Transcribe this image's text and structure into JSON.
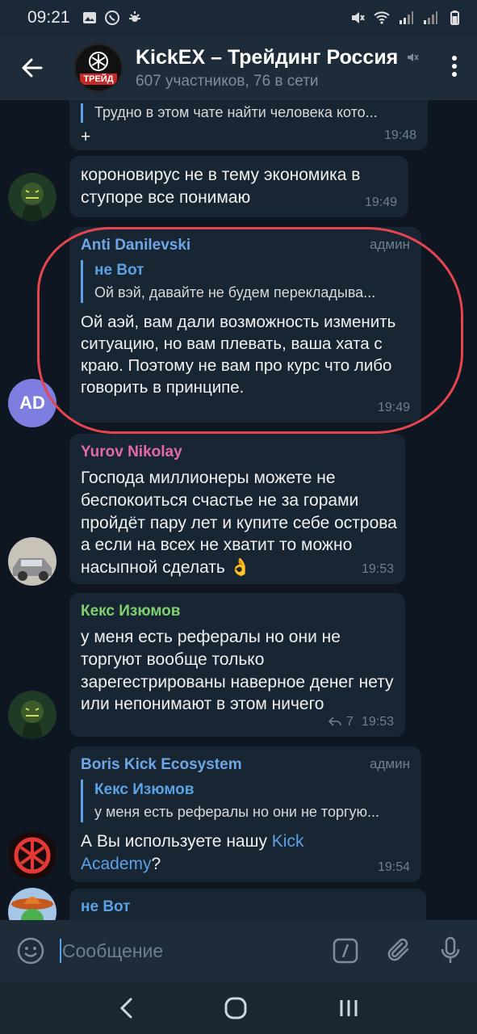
{
  "status": {
    "time": "09:21"
  },
  "chat": {
    "title": "KickEX – Трейдинг Россия",
    "subtitle": "607 участников, 76 в сети",
    "avatar_badge": "ТРЕЙД"
  },
  "messages": [
    {
      "text1": "Трудно в этом чате найти человека кото...",
      "text2": "+",
      "time": "19:48"
    },
    {
      "text": "короновирус не в тему экономика в ступоре все понимаю",
      "time": "19:49"
    },
    {
      "sender": "Anti Danilevski",
      "role": "админ",
      "reply_name": "не Вот",
      "reply_text": "Ой вэй,  давайте не будем перекладыва...",
      "text": "Ой аэй, вам дали возможность изменить ситуацию, но вам плевать, ваша хата с краю. Поэтому не вам про курс что либо говорить в принципе.",
      "time": "19:49",
      "avatar_initials": "AD"
    },
    {
      "sender": "Yurov Nikolay",
      "text": "Господа миллионеры можете не беспокоиться счастье не за горами пройдёт пару лет и купите себе острова а если на всех не хватит то можно насыпной сделать 👌",
      "time": "19:53"
    },
    {
      "sender": "Кекс Изюмов",
      "text": "у меня есть рефералы но они не торгуют вообще только зарегестрированы наверное денег нету или непонимают в этом ничего",
      "replies": "7",
      "time": "19:53"
    },
    {
      "sender": "Boris Kick Ecosystem",
      "role": "админ",
      "reply_name": "Кекс Изюмов",
      "reply_text": "у меня есть рефералы но они не торгую...",
      "text_before": "А Вы используете нашу ",
      "link": "Kick Academy",
      "text_after": "?",
      "time": "19:54"
    },
    {
      "sender": "не Вот"
    }
  ],
  "input": {
    "placeholder": "Сообщение"
  },
  "colors": {
    "accent": "#5aa2e4",
    "annotation": "#e64550",
    "sender_anti": "#6ea6e6",
    "sender_yurov": "#e46aa6",
    "sender_keks": "#7fd16f",
    "sender_boris": "#6ea6e6",
    "sender_ne_vot": "#5aa2e4"
  }
}
